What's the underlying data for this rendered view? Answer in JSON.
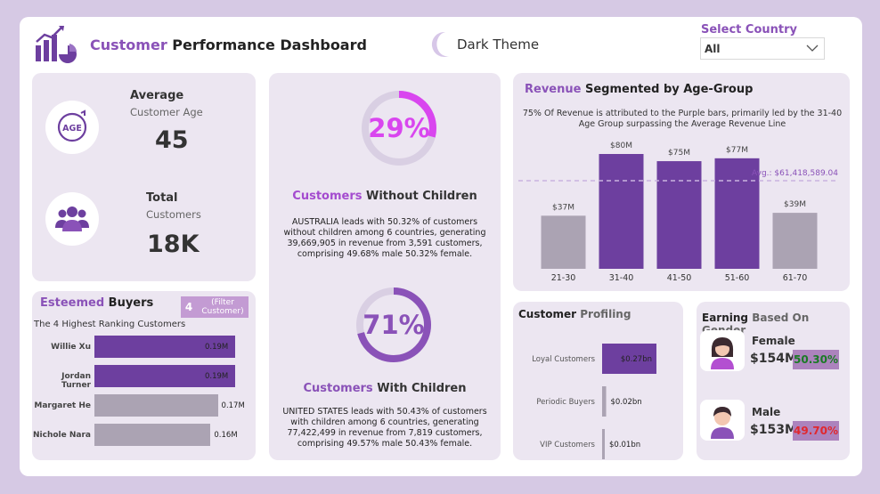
{
  "header": {
    "title_accent": "Customer",
    "title_rest": " Performance Dashboard",
    "theme_label": "Dark Theme",
    "country_label": "Select Country",
    "country_value": "All"
  },
  "kpis": {
    "age_icon_text": "AGE",
    "avg_age_heading": "Average",
    "avg_age_sub": "Customer Age",
    "avg_age_value": "45",
    "total_heading": "Total",
    "total_sub": "Customers",
    "total_value": "18K"
  },
  "esteemed": {
    "title_accent": "Esteemed",
    "title_rest": " Buyers",
    "filter_count": "4",
    "filter_text": "(Filter Customer)",
    "subtitle": "The 4 Highest Ranking Customers",
    "rows": [
      {
        "name": "Willie Xu",
        "value": 0.19,
        "label": "0.19M"
      },
      {
        "name": "Jordan Turner",
        "value": 0.19,
        "label": "0.19M"
      },
      {
        "name": "Margaret He",
        "value": 0.17,
        "label": "0.17M"
      },
      {
        "name": "Nichole Nara",
        "value": 0.16,
        "label": "0.16M"
      }
    ],
    "colors": {
      "dark": "#6d3f9f",
      "light": "#aba3b3"
    }
  },
  "without_children": {
    "percent": 29,
    "percent_label": "29%",
    "title_accent": "Customers",
    "title_rest": " Without Children",
    "body": "AUSTRALIA leads with 50.32% of customers without children among 6 countries, generating 39,669,905 in revenue from 3,591 customers, comprising 49.68% male 50.32% female.",
    "color": "#d946ef"
  },
  "with_children": {
    "percent": 71,
    "percent_label": "71%",
    "title_accent": "Customers",
    "title_rest": " With Children",
    "body": "UNITED STATES leads with 50.43% of customers with children among 6 countries, generating 77,422,499 in revenue from 7,819 customers, comprising 49.57% male 50.43% female.",
    "color": "#8a52b8"
  },
  "revenue": {
    "title_accent": "Revenue",
    "title_rest": " Segmented by Age-Group",
    "subtitle": "75% Of Revenue is attributed to the Purple bars, primarily led by the 31-40 Age Group surpassing the Average Revenue Line",
    "avg_label": "Avg.: $61,418,589.04"
  },
  "profiling": {
    "title_bold": "Customer",
    "title_rest": " Profiling"
  },
  "gender": {
    "title_bold": "Earning",
    "title_rest": " Based On Gender",
    "female": {
      "label": "Female",
      "amount": "$154M",
      "pct": "50.30%"
    },
    "male": {
      "label": "Male",
      "amount": "$153M",
      "pct": "49.70%"
    }
  },
  "chart_data": [
    {
      "type": "bar",
      "title": "Revenue Segmented by Age-Group",
      "categories": [
        "21-30",
        "31-40",
        "41-50",
        "51-60",
        "61-70"
      ],
      "values": [
        37,
        80,
        75,
        77,
        39
      ],
      "labels": [
        "$37M",
        "$80M",
        "$75M",
        "$77M",
        "$39M"
      ],
      "average": 61.418589,
      "average_label": "Avg.: $61,418,589.04",
      "colors": [
        "#aba3b3",
        "#6d3f9f",
        "#6d3f9f",
        "#6d3f9f",
        "#aba3b3"
      ],
      "ylim": [
        0,
        80
      ]
    },
    {
      "type": "bar",
      "title": "Customer Profiling",
      "orientation": "horizontal",
      "categories": [
        "Loyal Customers",
        "Periodic Buyers",
        "VIP Customers"
      ],
      "values": [
        0.27,
        0.02,
        0.01
      ],
      "labels": [
        "$0.27bn",
        "$0.02bn",
        "$0.01bn"
      ],
      "colors": [
        "#6d3f9f",
        "#aba3b3",
        "#aba3b3"
      ]
    }
  ]
}
